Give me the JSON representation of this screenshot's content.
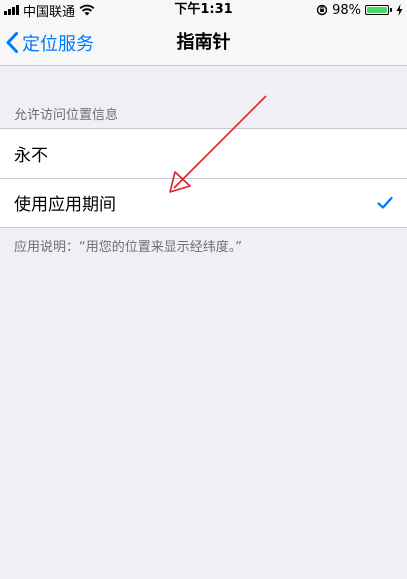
{
  "status_bar": {
    "carrier": "中国联通",
    "time": "下午1:31",
    "battery_percent": "98%",
    "battery_level": 0.98,
    "icons": [
      "signal-icon",
      "wifi-icon",
      "rotation-lock-icon",
      "battery-icon",
      "charging-icon"
    ]
  },
  "nav": {
    "back_label": "定位服务",
    "title": "指南针"
  },
  "section": {
    "header": "允许访问位置信息",
    "options": [
      {
        "label": "永不",
        "selected": false
      },
      {
        "label": "使用应用期间",
        "selected": true
      }
    ],
    "footer": "应用说明：“用您的位置来显示经纬度。”"
  },
  "colors": {
    "accent": "#007aff",
    "annotation": "#e0212b",
    "background": "#efeff4",
    "battery": "#4cd964"
  }
}
